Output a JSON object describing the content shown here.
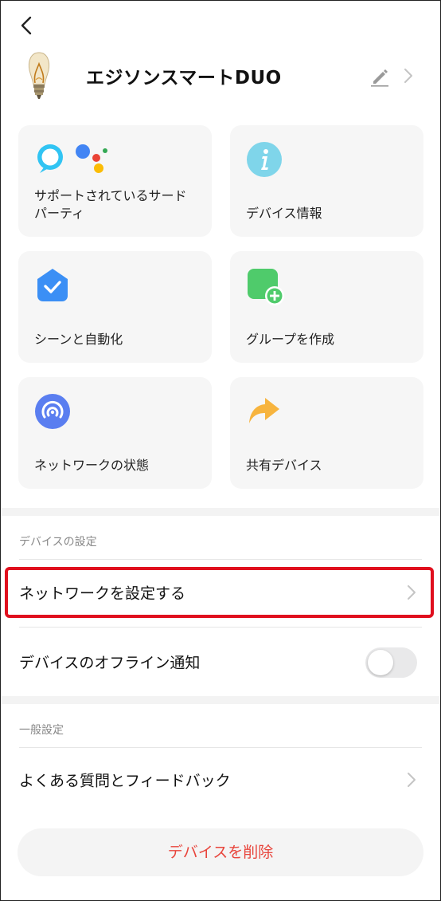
{
  "header": {
    "title": "エジソンスマートDUO"
  },
  "cards": [
    {
      "label": "サポートされているサードパーティ",
      "icon": "third-party-assistants-icon"
    },
    {
      "label": "デバイス情報",
      "icon": "info-icon"
    },
    {
      "label": "シーンと自動化",
      "icon": "scene-check-icon"
    },
    {
      "label": "グループを作成",
      "icon": "group-add-icon"
    },
    {
      "label": "ネットワークの状態",
      "icon": "network-status-icon"
    },
    {
      "label": "共有デバイス",
      "icon": "share-arrow-icon"
    }
  ],
  "device_settings": {
    "section_title": "デバイスの設定",
    "network_setup_label": "ネットワークを設定する",
    "offline_notify_label": "デバイスのオフライン通知",
    "offline_notify_enabled": false
  },
  "general_settings": {
    "section_title": "一般設定",
    "faq_label": "よくある質問とフィードバック"
  },
  "delete_label": "デバイスを削除",
  "colors": {
    "highlight_border": "#e00f1e",
    "delete_text": "#e8453c",
    "card_bg": "#f6f6f6"
  }
}
